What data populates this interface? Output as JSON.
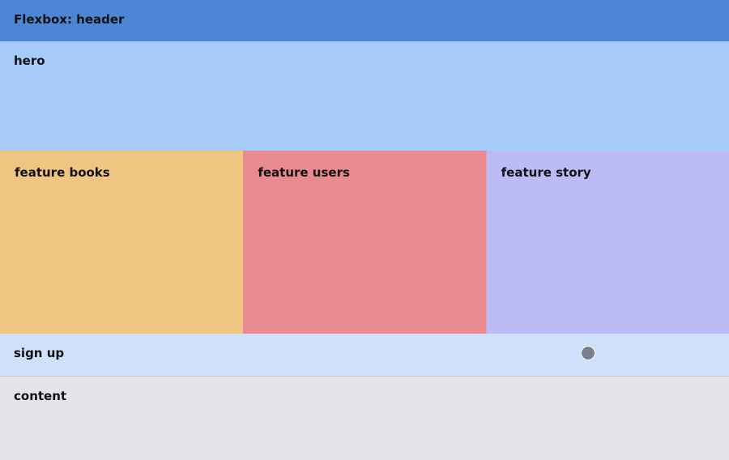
{
  "header": {
    "label": "Flexbox: header"
  },
  "hero": {
    "label": "hero"
  },
  "features": [
    {
      "label": "feature books"
    },
    {
      "label": "feature users"
    },
    {
      "label": "feature story"
    }
  ],
  "signup": {
    "label": "sign up"
  },
  "content": {
    "label": "content"
  },
  "colors": {
    "header": "#4d86d4",
    "hero": "#a7cbfb",
    "feature_books": "#f0c581",
    "feature_users": "#e88a90",
    "feature_story": "#bdbbf5",
    "signup": "#cfe0fa",
    "content": "#e3e5eb"
  }
}
